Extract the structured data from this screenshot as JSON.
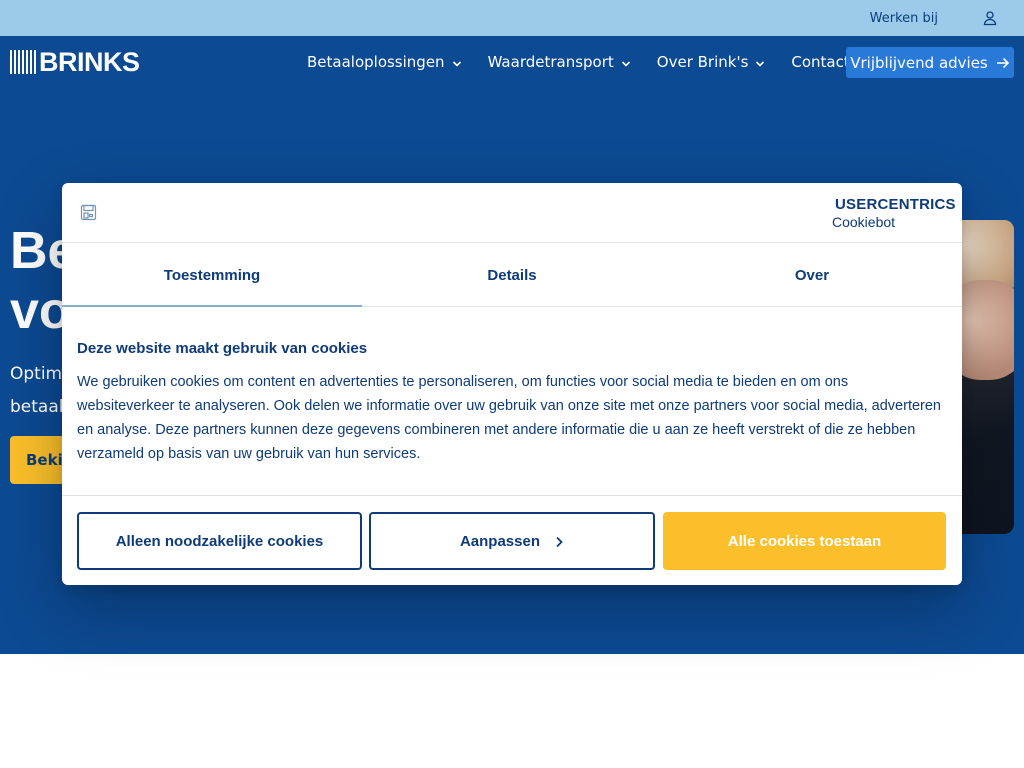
{
  "topbar": {
    "werken_bij": "Werken bij",
    "user_icon": "user-icon"
  },
  "header": {
    "logo_text": "BRINKS",
    "nav": [
      {
        "label": "Betaaloplossingen"
      },
      {
        "label": "Waardetransport"
      },
      {
        "label": "Over Brink's"
      },
      {
        "label": "Contact"
      }
    ],
    "cta_label": "Vrijblijvend advies"
  },
  "hero": {
    "title_visible": "Be\nvo",
    "subtitle_visible": "Optima\nbetaal",
    "cta_visible": "Bekij"
  },
  "cookie_dialog": {
    "brand_name": "USERCENTRICS",
    "brand_product": "Cookiebot",
    "tabs": [
      {
        "label": "Toestemming",
        "active": true
      },
      {
        "label": "Details",
        "active": false
      },
      {
        "label": "Over",
        "active": false
      }
    ],
    "heading": "Deze website maakt gebruik van cookies",
    "body": "We gebruiken cookies om content en advertenties te personaliseren, om functies voor social media te bieden en om ons websiteverkeer te analyseren. Ook delen we informatie over uw gebruik van onze site met onze partners voor social media, adverteren en analyse. Deze partners kunnen deze gegevens combineren met andere informatie die u aan ze heeft verstrekt of die ze hebben verzameld op basis van uw gebruik van hun services.",
    "buttons": {
      "necessary": "Alleen noodzakelijke cookies",
      "customize": "Aanpassen",
      "allow_all": "Alle cookies toestaan"
    }
  },
  "colors": {
    "topbar": "#9ccaeb",
    "hero_bg": "#0c4a93",
    "brand_navy": "#0f3b78",
    "accent_yellow": "#fbbf2b",
    "cta_blue": "#2979d8"
  }
}
